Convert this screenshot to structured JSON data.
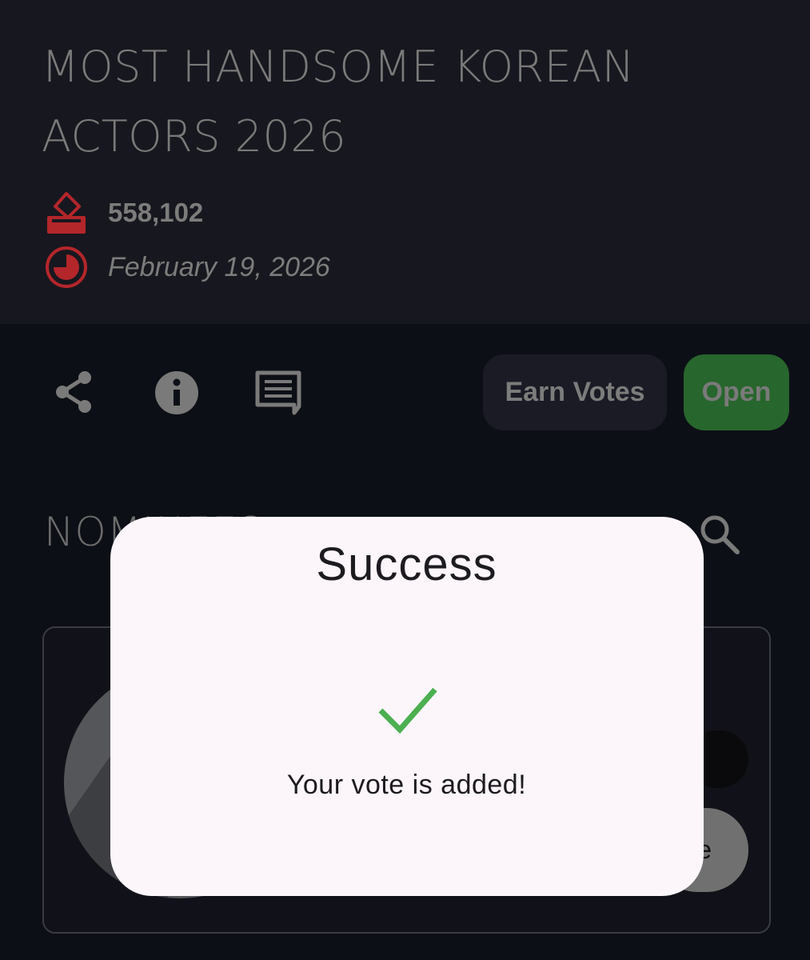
{
  "header": {
    "title": "MOST HANDSOME KOREAN ACTORS 2026",
    "votes": "558,102",
    "date": "February 19, 2026"
  },
  "actions": {
    "icons": [
      "share-icon",
      "info-icon",
      "comment-icon"
    ],
    "earn_votes_label": "Earn Votes",
    "open_label": "Open"
  },
  "nominees": {
    "section_title": "NOMINEES",
    "vote_button_partial_label": "e"
  },
  "dialog": {
    "title": "Success",
    "message": "Your vote is added!",
    "icon": "check-icon"
  },
  "colors": {
    "accent_red": "#b3262a",
    "open_green": "#27662c",
    "check_green": "#4caf50",
    "dialog_bg": "#fcf6fb"
  }
}
